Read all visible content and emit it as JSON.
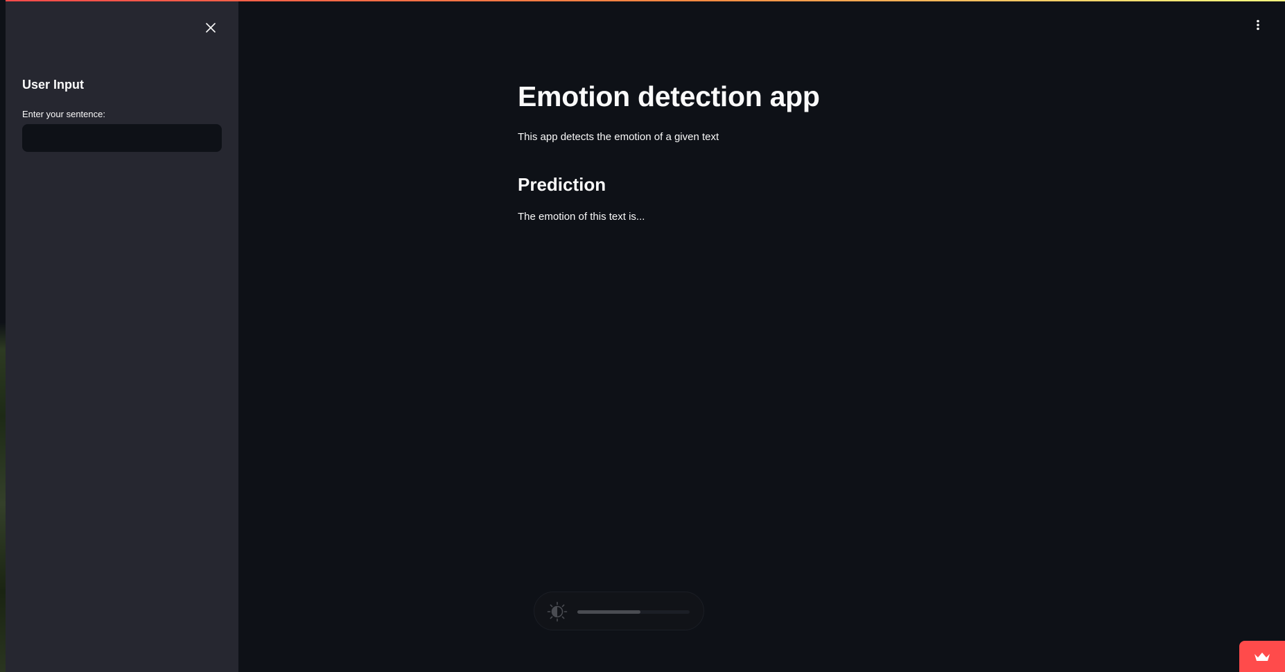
{
  "sidebar": {
    "heading": "User Input",
    "input_label": "Enter your sentence:",
    "input_value": "",
    "input_placeholder": "",
    "close_icon": "close-icon"
  },
  "main": {
    "title": "Emotion detection app",
    "description": "This app detects the emotion of a given text",
    "prediction_heading": "Prediction",
    "prediction_text": "The emotion of this text is..."
  },
  "toolbar": {
    "menu_icon": "vertical-dots-icon"
  },
  "brightness": {
    "icon": "brightness-contrast-icon",
    "level_percent": 56
  },
  "badge": {
    "icon": "crown-icon"
  },
  "colors": {
    "background": "#0e1117",
    "sidebar": "#262730",
    "text": "#fafafa",
    "accent": "#ff4b4b",
    "gradient_end": "#fffd80"
  }
}
